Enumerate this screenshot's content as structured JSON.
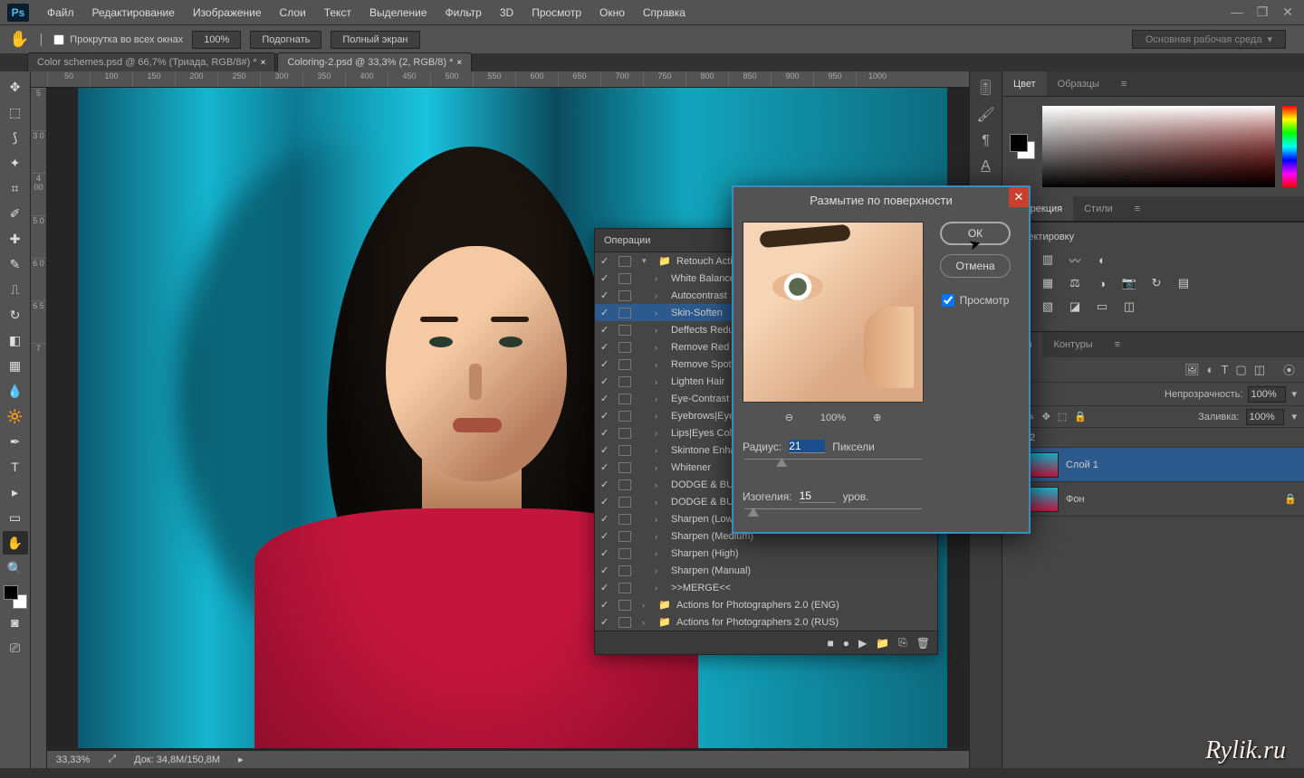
{
  "menubar": {
    "logo": "Ps",
    "items": [
      "Файл",
      "Редактирование",
      "Изображение",
      "Слои",
      "Текст",
      "Выделение",
      "Фильтр",
      "3D",
      "Просмотр",
      "Окно",
      "Справка"
    ]
  },
  "optionsbar": {
    "scroll_all": "Прокрутка во всех окнах",
    "zoom": "100%",
    "fit": "Подогнать",
    "full": "Полный экран",
    "workspace": "Основная рабочая среда"
  },
  "tabs": [
    {
      "label": "Color schemes.psd @ 66,7% (Триада, RGB/8#) *",
      "active": false
    },
    {
      "label": "Coloring-2.psd @ 33,3% (2, RGB/8) *",
      "active": true
    }
  ],
  "ruler_h": [
    "50",
    "100",
    "150",
    "200",
    "250",
    "300",
    "350",
    "400",
    "450",
    "500",
    "550",
    "600",
    "650",
    "700",
    "750",
    "800",
    "850",
    "900",
    "950",
    "1000"
  ],
  "ruler_v": [
    "5",
    "3 0",
    "4 00",
    "5 0",
    "6 0",
    "6 5",
    "7"
  ],
  "actions": {
    "title": "Операции",
    "items": [
      {
        "indent": 0,
        "folder": true,
        "chev": "▾",
        "label": "Retouch Action"
      },
      {
        "indent": 1,
        "chev": "›",
        "label": "White Balance"
      },
      {
        "indent": 1,
        "chev": "›",
        "label": "Autocontrast"
      },
      {
        "indent": 1,
        "chev": "›",
        "label": "Skin-Soften",
        "selected": true
      },
      {
        "indent": 1,
        "chev": "›",
        "label": "Deffects Reduce"
      },
      {
        "indent": 1,
        "chev": "›",
        "label": "Remove Red"
      },
      {
        "indent": 1,
        "chev": "›",
        "label": "Remove Spots"
      },
      {
        "indent": 1,
        "chev": "›",
        "label": "Lighten Hair"
      },
      {
        "indent": 1,
        "chev": "›",
        "label": "Eye-Contrast"
      },
      {
        "indent": 1,
        "chev": "›",
        "label": "Eyebrows|Eyelas"
      },
      {
        "indent": 1,
        "chev": "›",
        "label": "Lips|Eyes Colorin"
      },
      {
        "indent": 1,
        "chev": "›",
        "label": "Skintone Enhanc"
      },
      {
        "indent": 1,
        "chev": "›",
        "label": "Whitener"
      },
      {
        "indent": 1,
        "chev": "›",
        "label": "DODGE & BURN"
      },
      {
        "indent": 1,
        "chev": "›",
        "label": "DODGE & BURN"
      },
      {
        "indent": 1,
        "chev": "›",
        "label": "Sharpen (Low)"
      },
      {
        "indent": 1,
        "chev": "›",
        "label": "Sharpen (Medium)"
      },
      {
        "indent": 1,
        "chev": "›",
        "label": "Sharpen (High)"
      },
      {
        "indent": 1,
        "chev": "›",
        "label": "Sharpen (Manual)"
      },
      {
        "indent": 1,
        "chev": "›",
        "label": ">>MERGE<<"
      },
      {
        "indent": 0,
        "folder": true,
        "chev": "›",
        "label": "Actions for Photographers 2.0 (ENG)"
      },
      {
        "indent": 0,
        "folder": true,
        "chev": "›",
        "label": "Actions for Photographers 2.0 (RUS)"
      }
    ]
  },
  "dialog": {
    "title": "Размытие по поверхности",
    "ok": "ОК",
    "cancel": "Отмена",
    "preview": "Просмотр",
    "zoom": "100%",
    "radius_label": "Радиус:",
    "radius": "21",
    "radius_unit": "Пиксели",
    "threshold_label": "Изогелия:",
    "threshold": "15",
    "threshold_unit": "уров."
  },
  "right": {
    "color_tab": "Цвет",
    "swatch_tab": "Образцы",
    "adjust_tab": "Коррекция",
    "styles_tab": "Стили",
    "adjust_heading": "орректировку",
    "layers_tab": "алы",
    "paths_tab": "Контуры",
    "opacity_label": "Непрозрачность:",
    "opacity": "100%",
    "fill_label": "Заливка:",
    "fill": "100%",
    "layer1": "Слой 1",
    "layer_bg": "Фон"
  },
  "status": {
    "zoom": "33,33%",
    "doc": "Док: 34,8M/150,8M"
  },
  "watermark": "Rylik.ru"
}
